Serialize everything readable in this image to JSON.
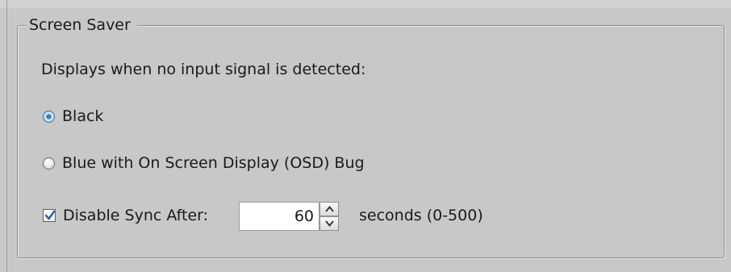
{
  "groupbox": {
    "title": "Screen Saver"
  },
  "description": "Displays when no input signal is detected:",
  "options": [
    {
      "label": "Black",
      "selected": true
    },
    {
      "label": "Blue with On Screen Display (OSD) Bug",
      "selected": false
    }
  ],
  "disable_sync": {
    "label": "Disable Sync After:",
    "checked": true,
    "value": "60",
    "units": "seconds (0-500)"
  },
  "colors": {
    "background": "#c8c8c8",
    "radio_selected": "#2f78bd",
    "check_mark": "#2b5aa8"
  },
  "icons": {
    "spin_up": "chevron-up-icon",
    "spin_down": "chevron-down-icon",
    "check": "checkmark-icon"
  }
}
